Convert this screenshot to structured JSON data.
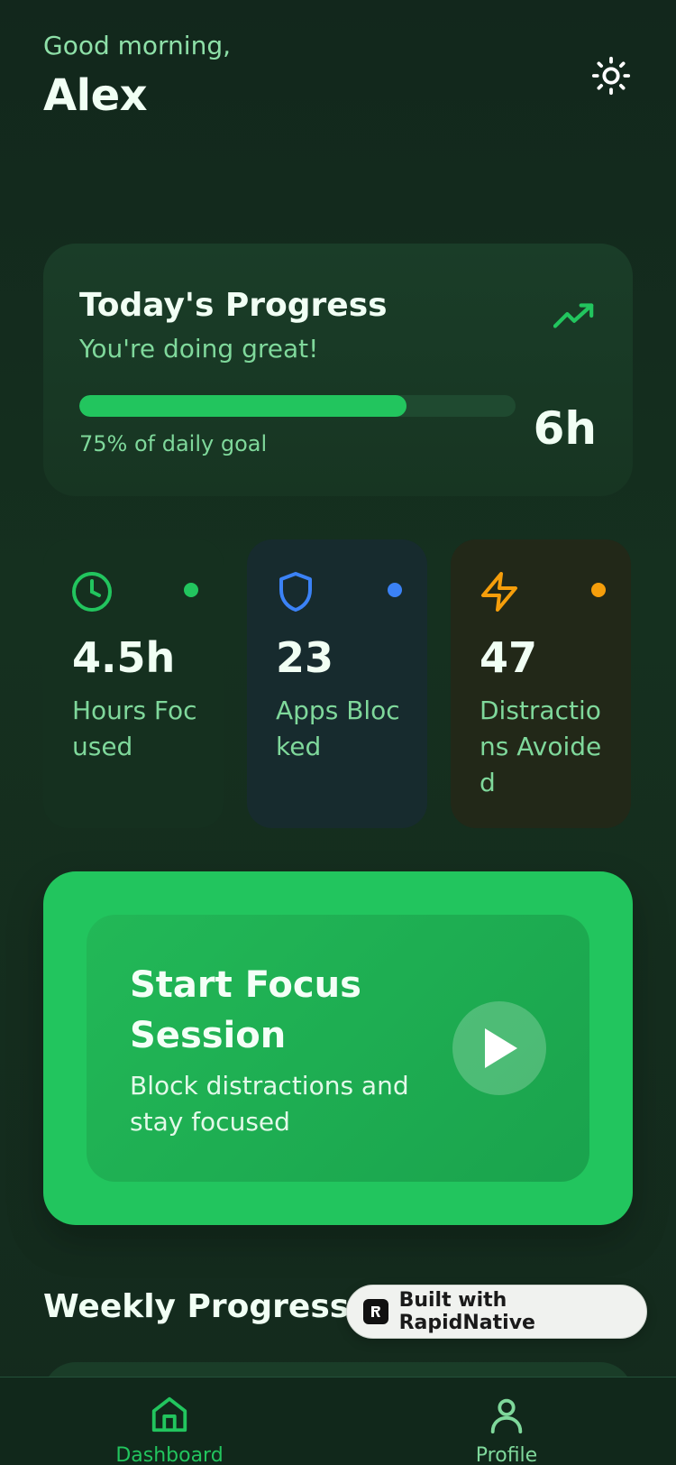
{
  "header": {
    "greeting": "Good morning,",
    "user_name": "Alex",
    "theme_icon": "sun-icon"
  },
  "progress": {
    "title": "Today's Progress",
    "subtitle": "You're doing great!",
    "trend_icon": "trending-up-icon",
    "percent": 75,
    "goal_text": "75% of daily goal",
    "hours": "6h"
  },
  "stats": [
    {
      "icon": "clock-icon",
      "value": "4.5h",
      "label": "Hours Focused",
      "color": "#22c55e"
    },
    {
      "icon": "shield-icon",
      "value": "23",
      "label": "Apps Blocked",
      "color": "#3b82f6"
    },
    {
      "icon": "lightning-icon",
      "value": "47",
      "label": "Distractions Avoided",
      "color": "#f59e0b"
    }
  ],
  "focus": {
    "title": "Start Focus Session",
    "subtitle": "Block distractions and stay focused",
    "play_icon": "play-icon"
  },
  "weekly": {
    "title": "Weekly Progress"
  },
  "badge": {
    "label": "Built with RapidNative"
  },
  "nav": {
    "items": [
      {
        "label": "Dashboard",
        "icon": "home-icon",
        "active": true
      },
      {
        "label": "Profile",
        "icon": "user-icon",
        "active": false
      }
    ]
  },
  "colors": {
    "accent": "#22c55e",
    "background": "#132a1e",
    "muted_text": "#7fd89b"
  }
}
